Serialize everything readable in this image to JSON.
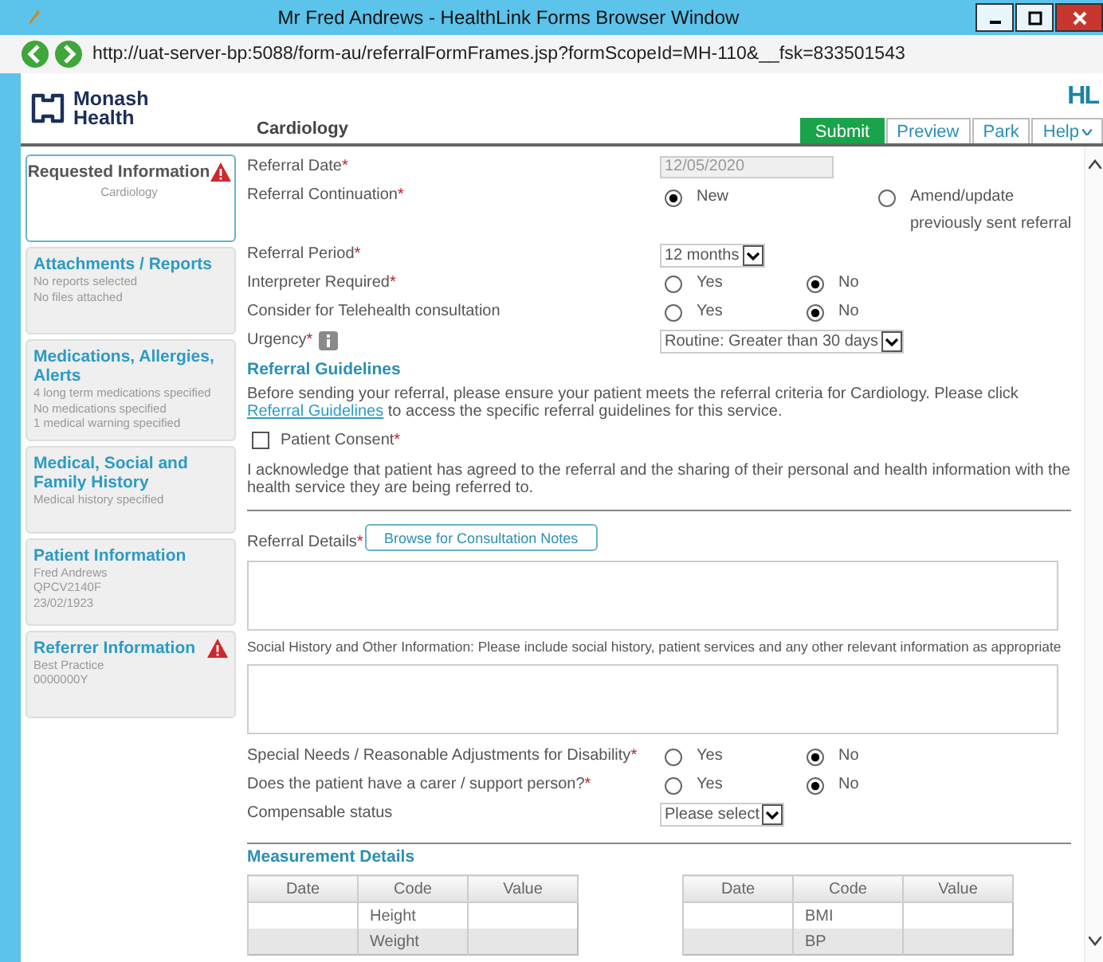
{
  "window": {
    "title": "Mr Fred Andrews - HealthLink Forms Browser Window"
  },
  "address_bar": {
    "url": "http://uat-server-bp:5088/form-au/referralFormFrames.jsp?formScopeId=MH-110&__fsk=833501543"
  },
  "header": {
    "logo_lines": [
      "Monash",
      "Health"
    ],
    "brand": "HL",
    "section_title": "Cardiology",
    "actions": [
      {
        "label": "Submit",
        "kind": "primary"
      },
      {
        "label": "Preview",
        "kind": "link"
      },
      {
        "label": "Park",
        "kind": "link"
      },
      {
        "label": "Help",
        "kind": "menu"
      }
    ]
  },
  "sidebar": {
    "items": [
      {
        "title": "Requested Information",
        "warning": true,
        "selected": true,
        "lines": [
          "Cardiology"
        ]
      },
      {
        "title": "Attachments / Reports",
        "warning": false,
        "selected": false,
        "lines": [
          "No reports selected",
          "No files attached"
        ]
      },
      {
        "title": "Medications, Allergies, Alerts",
        "warning": false,
        "selected": false,
        "lines": [
          "4 long term medications specified",
          "No medications specified",
          "1 medical warning specified"
        ]
      },
      {
        "title": "Medical, Social and Family History",
        "warning": false,
        "selected": false,
        "lines": [
          "Medical history specified"
        ]
      },
      {
        "title": "Patient Information",
        "warning": false,
        "selected": false,
        "lines": [
          "Fred Andrews",
          "QPCV2140F",
          "23/02/1923"
        ]
      },
      {
        "title": "Referrer Information",
        "warning": true,
        "selected": false,
        "lines": [
          "Best Practice",
          "0000000Y"
        ]
      }
    ]
  },
  "form": {
    "fields": [
      {
        "kind": "date",
        "label": "Referral Date",
        "required_mark": "*",
        "disabled": true,
        "value": "12/05/2020"
      },
      {
        "kind": "radio-wide",
        "label": "Referral Continuation",
        "required_mark": "*",
        "options": [
          {
            "label": "New",
            "selected": true
          },
          {
            "label": "Amend/update previously sent referral",
            "selected": false
          }
        ]
      },
      {
        "kind": "select",
        "label": "Referral Period",
        "required_mark": "*",
        "value": "12 months"
      },
      {
        "kind": "radio",
        "label": "Interpreter Required",
        "required_mark": "*",
        "options": [
          {
            "label": "Yes",
            "selected": false
          },
          {
            "label": "No",
            "selected": true
          }
        ]
      },
      {
        "kind": "radio",
        "label": "Consider for Telehealth consultation",
        "options": [
          {
            "label": "Yes",
            "selected": false
          },
          {
            "label": "No",
            "selected": true
          }
        ]
      },
      {
        "kind": "select",
        "label": "Urgency",
        "required_mark": "*",
        "info": true,
        "value": "Routine: Greater than 30 days"
      }
    ],
    "guidelines": {
      "heading": "Referral Guidelines",
      "before": "Before sending your referral, please ensure your patient meets the referral criteria for Cardiology. Please click ",
      "link": "Referral Guidelines",
      "after": " to access the specific referral guidelines for this service."
    },
    "consent": {
      "label": "Patient Consent",
      "required_mark": "*",
      "checked": false
    },
    "acknowledgement": "I acknowledge that patient has agreed to the referral and the sharing of their personal and health information with the health service they are being referred to.",
    "referral_details": {
      "label": "Referral Details",
      "required_mark": "*",
      "button": "Browse for Consultation Notes"
    },
    "social_history": {
      "label": "Social History and Other Information: Please include social history, patient services and any other relevant information as appropriate"
    },
    "more_fields": [
      {
        "kind": "radio",
        "label": "Special Needs / Reasonable Adjustments for Disability",
        "required_mark": "*",
        "options": [
          {
            "label": "Yes",
            "selected": false
          },
          {
            "label": "No",
            "selected": true
          }
        ]
      },
      {
        "kind": "radio",
        "label": "Does the patient have a carer / support person?",
        "required_mark": "*",
        "options": [
          {
            "label": "Yes",
            "selected": false
          },
          {
            "label": "No",
            "selected": true
          }
        ]
      },
      {
        "kind": "select",
        "label": "Compensable status",
        "value": "Please select"
      }
    ],
    "measurements": {
      "heading": "Measurement Details",
      "tables": [
        {
          "columns": [
            "Date",
            "Code",
            "Value"
          ],
          "rows": [
            {
              "code": "Height"
            },
            {
              "code": "Weight"
            }
          ]
        },
        {
          "columns": [
            "Date",
            "Code",
            "Value"
          ],
          "rows": [
            {
              "code": "BMI"
            },
            {
              "code": "BP"
            }
          ]
        }
      ]
    }
  }
}
